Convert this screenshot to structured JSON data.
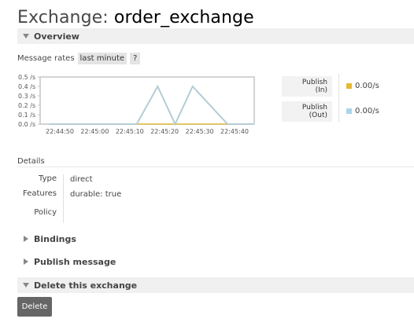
{
  "title": {
    "prefix": "Exchange:",
    "name": "order_exchange"
  },
  "sections": {
    "overview": "Overview",
    "bindings": "Bindings",
    "publish_message": "Publish message",
    "delete_exchange": "Delete this exchange"
  },
  "message_rates": {
    "label": "Message rates",
    "range": "last minute",
    "help": "?"
  },
  "chart_data": {
    "type": "line",
    "title": "",
    "xlabel": "",
    "ylabel": "",
    "ylim": [
      0,
      0.5
    ],
    "y_ticks": [
      "0.5 /s",
      "0.4 /s",
      "0.3 /s",
      "0.2 /s",
      "0.1 /s",
      "0.0 /s"
    ],
    "x_ticks": [
      "22:44:50",
      "22:45:00",
      "22:45:10",
      "22:45:20",
      "22:45:30",
      "22:45:40"
    ],
    "series": [
      {
        "name": "Publish (In)",
        "color": "#e0b93b",
        "x_sec": [
          0,
          10,
          20,
          30,
          40,
          50,
          60
        ],
        "values": [
          0,
          0,
          0,
          0,
          0,
          0,
          0
        ]
      },
      {
        "name": "Publish (Out)",
        "color": "#b4cdd4",
        "x_sec": [
          -3,
          22,
          28,
          33,
          38,
          48,
          58,
          63
        ],
        "values": [
          0,
          0,
          0.4,
          0,
          0.4,
          0,
          0,
          0
        ]
      }
    ]
  },
  "legend": [
    {
      "label_line1": "Publish",
      "label_line2": "(In)",
      "value": "0.00/s",
      "color": "#e8b832"
    },
    {
      "label_line1": "Publish",
      "label_line2": "(Out)",
      "value": "0.00/s",
      "color": "#a9d4ec"
    }
  ],
  "details": {
    "label": "Details",
    "type_key": "Type",
    "type_value": "direct",
    "features_key": "Features",
    "features_durable_key": "durable:",
    "features_durable_value": "true",
    "policy_key": "Policy"
  },
  "delete_button": "Delete"
}
